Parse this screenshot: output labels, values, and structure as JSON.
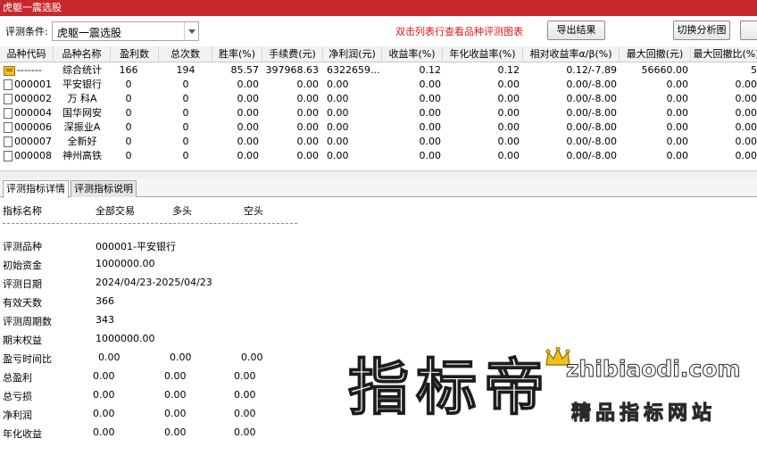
{
  "window_title": "虎躯一震选股",
  "toolbar": {
    "condition_label": "评测条件:",
    "condition_value": "虎躯一震选股",
    "hint": "双击列表行查看品种评测图表",
    "export_label": "导出结果",
    "switch_label": "切换分析图"
  },
  "grid": {
    "columns": [
      "品种代码",
      "品种名称",
      "盈利数",
      "总次数",
      "胜率(%)",
      "手续费(元)",
      "净利润(元)",
      "收益率(%)",
      "年化收益率(%)",
      "相对收益率α/β(%)",
      "最大回撤(元)",
      "最大回撤比(%)"
    ],
    "rows": [
      {
        "icon": "folder-icon",
        "code": "-------",
        "name": "综合统计",
        "win": "166",
        "total": "194",
        "rate": "85.57",
        "fee": "397968.63",
        "net": "6322659....",
        "ret": "0.12",
        "ann": "0.12",
        "rel": "0.12/-7.89",
        "mdd": "56660.00",
        "mddr": "5"
      },
      {
        "icon": "doc-icon",
        "code": "000001",
        "name": "平安银行",
        "win": "0",
        "total": "0",
        "rate": "0.00",
        "fee": "0.00",
        "net": "0.00",
        "ret": "0.00",
        "ann": "0.00",
        "rel": "0.00/-8.00",
        "mdd": "0.00",
        "mddr": "0.00"
      },
      {
        "icon": "doc-icon",
        "code": "000002",
        "name": "万 科A",
        "win": "0",
        "total": "0",
        "rate": "0.00",
        "fee": "0.00",
        "net": "0.00",
        "ret": "0.00",
        "ann": "0.00",
        "rel": "0.00/-8.00",
        "mdd": "0.00",
        "mddr": "0.00"
      },
      {
        "icon": "doc-icon",
        "code": "000004",
        "name": "国华网安",
        "win": "0",
        "total": "0",
        "rate": "0.00",
        "fee": "0.00",
        "net": "0.00",
        "ret": "0.00",
        "ann": "0.00",
        "rel": "0.00/-8.00",
        "mdd": "0.00",
        "mddr": "0.00"
      },
      {
        "icon": "doc-icon",
        "code": "000006",
        "name": "深振业A",
        "win": "0",
        "total": "0",
        "rate": "0.00",
        "fee": "0.00",
        "net": "0.00",
        "ret": "0.00",
        "ann": "0.00",
        "rel": "0.00/-8.00",
        "mdd": "0.00",
        "mddr": "0.00"
      },
      {
        "icon": "doc-icon",
        "code": "000007",
        "name": "全新好",
        "win": "0",
        "total": "0",
        "rate": "0.00",
        "fee": "0.00",
        "net": "0.00",
        "ret": "0.00",
        "ann": "0.00",
        "rel": "0.00/-8.00",
        "mdd": "0.00",
        "mddr": "0.00"
      },
      {
        "icon": "doc-icon",
        "code": "000008",
        "name": "神州高铁",
        "win": "0",
        "total": "0",
        "rate": "0.00",
        "fee": "0.00",
        "net": "0.00",
        "ret": "0.00",
        "ann": "0.00",
        "rel": "0.00/-8.00",
        "mdd": "0.00",
        "mddr": "0.00"
      }
    ]
  },
  "tabs": [
    "评测指标详情",
    "评测指标说明"
  ],
  "detail": {
    "headers": [
      "指标名称",
      "全部交易",
      "多头",
      "空头"
    ],
    "info": [
      {
        "label": "评测品种",
        "value": "000001-平安银行"
      },
      {
        "label": "初始资金",
        "value": "1000000.00"
      },
      {
        "label": "评测日期",
        "value": "2024/04/23-2025/04/23"
      },
      {
        "label": "有效天数",
        "value": "366"
      },
      {
        "label": "评测周期数",
        "value": "343"
      },
      {
        "label": "期末权益",
        "value": "1000000.00"
      }
    ],
    "metrics": [
      {
        "label": "盈亏时间比",
        "all": "0.00",
        "long": "0.00",
        "short": "0.00"
      },
      {
        "label": "总盈利",
        "all": "0.00",
        "long": "0.00",
        "short": "0.00"
      },
      {
        "label": "总亏损",
        "all": "0.00",
        "long": "0.00",
        "short": "0.00"
      },
      {
        "label": "净利润",
        "all": "0.00",
        "long": "0.00",
        "short": "0.00"
      },
      {
        "label": "年化收益",
        "all": "0.00",
        "long": "0.00",
        "short": "0.00"
      }
    ]
  },
  "watermark": {
    "cn": "指标帝",
    "url": "zhibiaodi.com",
    "sub": "精品指标网站"
  },
  "colors": {
    "titlebar": "#c8282d",
    "hint": "#e0141e"
  }
}
